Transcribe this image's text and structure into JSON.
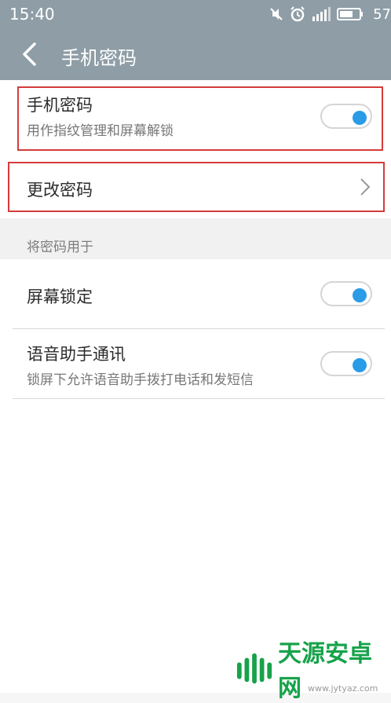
{
  "status_bar": {
    "time": "15:40",
    "battery_text": "57"
  },
  "app_bar": {
    "title": "手机密码"
  },
  "settings": {
    "phone_password": {
      "title": "手机密码",
      "subtitle": "用作指纹管理和屏幕解锁",
      "enabled": true
    },
    "change_password": {
      "title": "更改密码"
    },
    "section_label": "将密码用于",
    "screen_lock": {
      "title": "屏幕锁定",
      "enabled": true
    },
    "voice_assistant": {
      "title": "语音助手通讯",
      "subtitle": "锁屏下允许语音助手拨打电话和发短信",
      "enabled": true
    }
  },
  "watermark": {
    "brand": "天源安卓网",
    "url": "www.jytyaz.com"
  },
  "colors": {
    "app_bar": "#8e9da6",
    "toggle_knob": "#2a9be6",
    "highlight": "#d43c3c",
    "watermark_green": "#17a24a"
  }
}
